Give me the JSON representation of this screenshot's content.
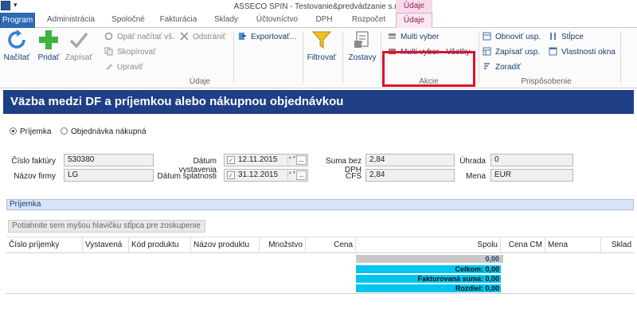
{
  "window": {
    "title": "ASSECO SPIN - Testovanie&predvádzanie s.r.o",
    "context_tab_header": "Údaje",
    "quick_access": "▾"
  },
  "tabs": [
    {
      "label": "Program"
    },
    {
      "label": "Administrácia"
    },
    {
      "label": "Spoločné"
    },
    {
      "label": "Fakturácia"
    },
    {
      "label": "Sklady"
    },
    {
      "label": "Účtovníctvo"
    },
    {
      "label": "DPH"
    },
    {
      "label": "Rozpočet"
    },
    {
      "label": "Údaje"
    }
  ],
  "ribbon": {
    "big_buttons": {
      "nacitat": "Načítať",
      "pridat": "Pridať",
      "zapisat": "Zapísať",
      "filtrovat": "Filtrovať",
      "zostavy": "Zostavy"
    },
    "small_buttons": {
      "opat_nacitat": "Opäť načítať vš.",
      "odstranit": "Odstrániť",
      "skopirovat": "Skopírovať",
      "upravit": "Upraviť",
      "exportovat": "Exportovať...",
      "multi_vyber": "Multi vyber",
      "multi_vyber_vsetky": "Multi vyber - Všetky",
      "obnovit_usp": "Obnoviť usp.",
      "zapisat_usp": "Zapísať usp.",
      "zoradit": "Zoradiť",
      "stlpce": "Stĺpce",
      "vlastnosti_okna": "Vlastnosti okna"
    },
    "groups": {
      "udaje": "Údaje",
      "akcie": "Akcie",
      "prisposobenie": "Prispôsobenie"
    }
  },
  "panel": {
    "title": "Väzba medzi DF a príjemkou alebo nákupnou objednávkou"
  },
  "radios": {
    "prijemka": "Príjemka",
    "objednavka": "Objednávka nákupná"
  },
  "fields": {
    "cislo_faktury_label": "Číslo faktúry",
    "cislo_faktury_value": "530380",
    "nazov_firmy_label": "Názov firmy",
    "nazov_firmy_value": "LG",
    "datum_vystavenia_label": "Dátum vystavenia",
    "datum_vystavenia_value": "12.11.2015",
    "datum_splatnosti_label": "Dátum splatnosti",
    "datum_splatnosti_value": "31.12.2015",
    "suma_bez_dph_label": "Suma bez DPH",
    "suma_bez_dph_value": "2,84",
    "cfs_label": "CFS",
    "cfs_value": "2,84",
    "uhrada_label": "Úhrada",
    "uhrada_value": "0",
    "mena_label": "Mena",
    "mena_value": "EUR",
    "checkbox_mark": "✓",
    "spin_glyph": "▲▼",
    "dots_glyph": "..."
  },
  "grid": {
    "caption": "Príjemka",
    "group_by_hint": "Potiahnite sem myšou hlavičku stĺpca pre zoskupenie",
    "columns": [
      "Číslo príjemky",
      "Vystavená",
      "Kód produktu",
      "Názov produktu",
      "Množstvo",
      "Cena",
      "Spolu",
      "Cena CM",
      "Mena",
      "Sklad"
    ],
    "summary": {
      "total": "0,00",
      "celkom": "Celkom: 0,00",
      "fakturovana": "Fakturovaná suma: 0,00",
      "rozdiel": "Rozdiel: 0,00"
    }
  },
  "colors": {
    "program_tab": "#2e6bb5",
    "panel_header": "#1e3f86",
    "summary_cyan": "#00c5ef",
    "highlight_red": "#e0102a"
  }
}
